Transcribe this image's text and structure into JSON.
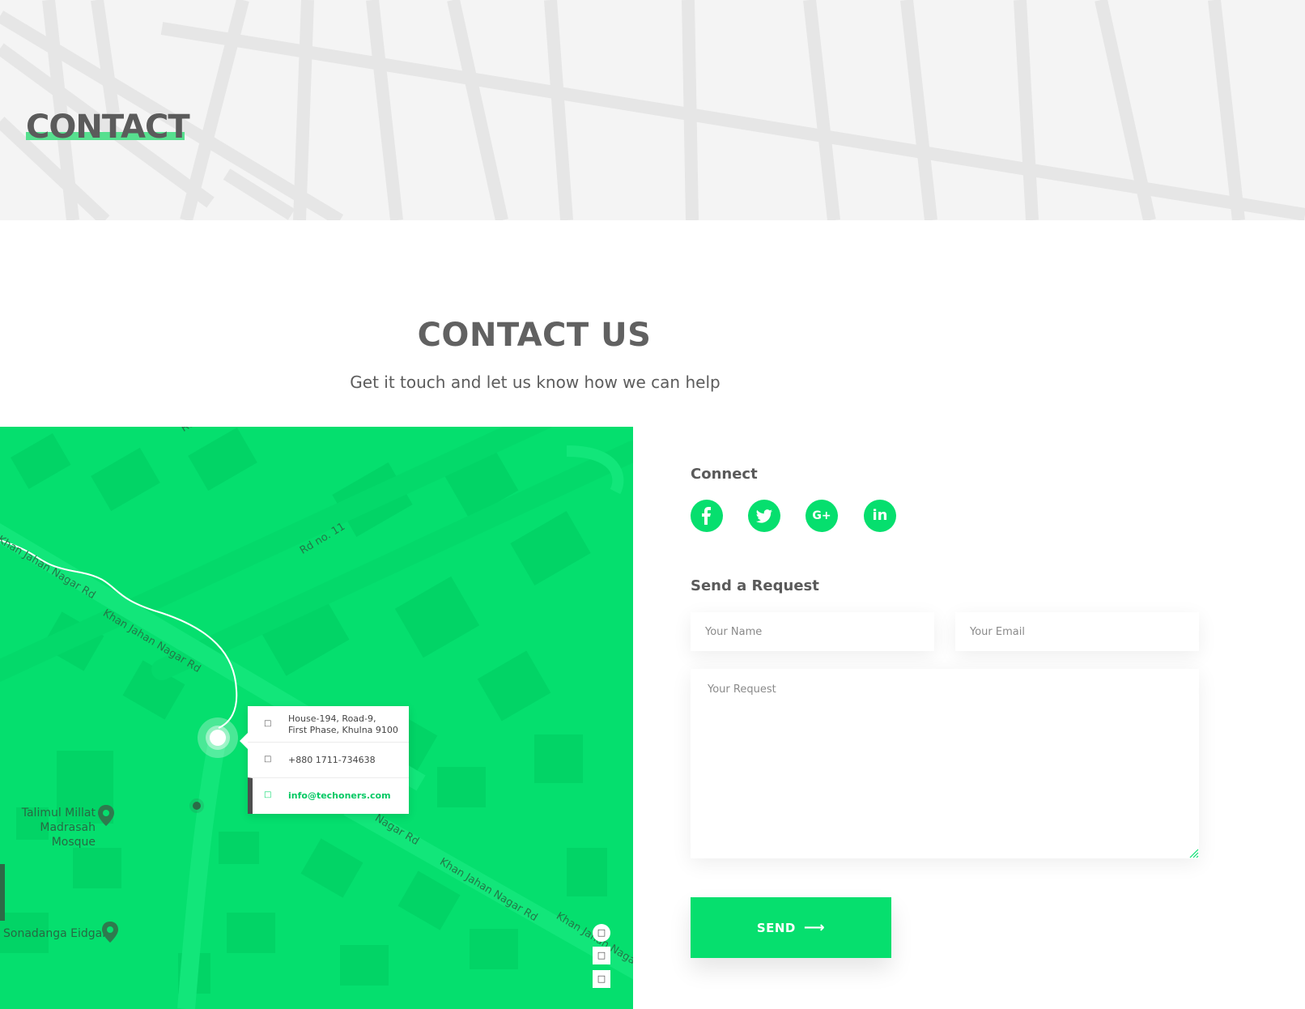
{
  "hero": {
    "title": "CONTACT"
  },
  "section": {
    "title": "CONTACT US",
    "subtitle": "Get it touch and let us know how we can help"
  },
  "map": {
    "roads": [
      "Khan Jahan Nagar Rd",
      "Khan Jahan Nagar Rd",
      "Rd no. 11",
      "Rd",
      "Nagar Rd",
      "Khan Jahan Nagar Rd",
      "Khan Jahan Naga"
    ],
    "pois": [
      "Talimul Millat\nMadrasah Mosque",
      "Sonadanga Eidgah"
    ],
    "info": {
      "address_icon": "map-marker-icon",
      "address": "House-194, Road-9,\nFirst Phase, Khulna 9100",
      "phone_icon": "phone-icon",
      "phone": "+880 1711-734638",
      "email_icon": "envelope-icon",
      "email": "info@techoners.com"
    },
    "controls": [
      "locate-icon",
      "zoom-in-icon",
      "zoom-out-icon"
    ]
  },
  "connect": {
    "label": "Connect",
    "socials": [
      {
        "name": "facebook-icon",
        "glyph": "f"
      },
      {
        "name": "twitter-icon",
        "glyph": "t"
      },
      {
        "name": "google-plus-icon",
        "glyph": "G+"
      },
      {
        "name": "linkedin-icon",
        "glyph": "in"
      }
    ]
  },
  "form": {
    "label": "Send a Request",
    "name_placeholder": "Your Name",
    "email_placeholder": "Your Email",
    "request_placeholder": "Your Request",
    "send_label": "SEND",
    "send_arrow": "⟶"
  },
  "colors": {
    "accent": "#06df6e",
    "text": "#616161",
    "hero_bg": "#f4f4f4"
  }
}
